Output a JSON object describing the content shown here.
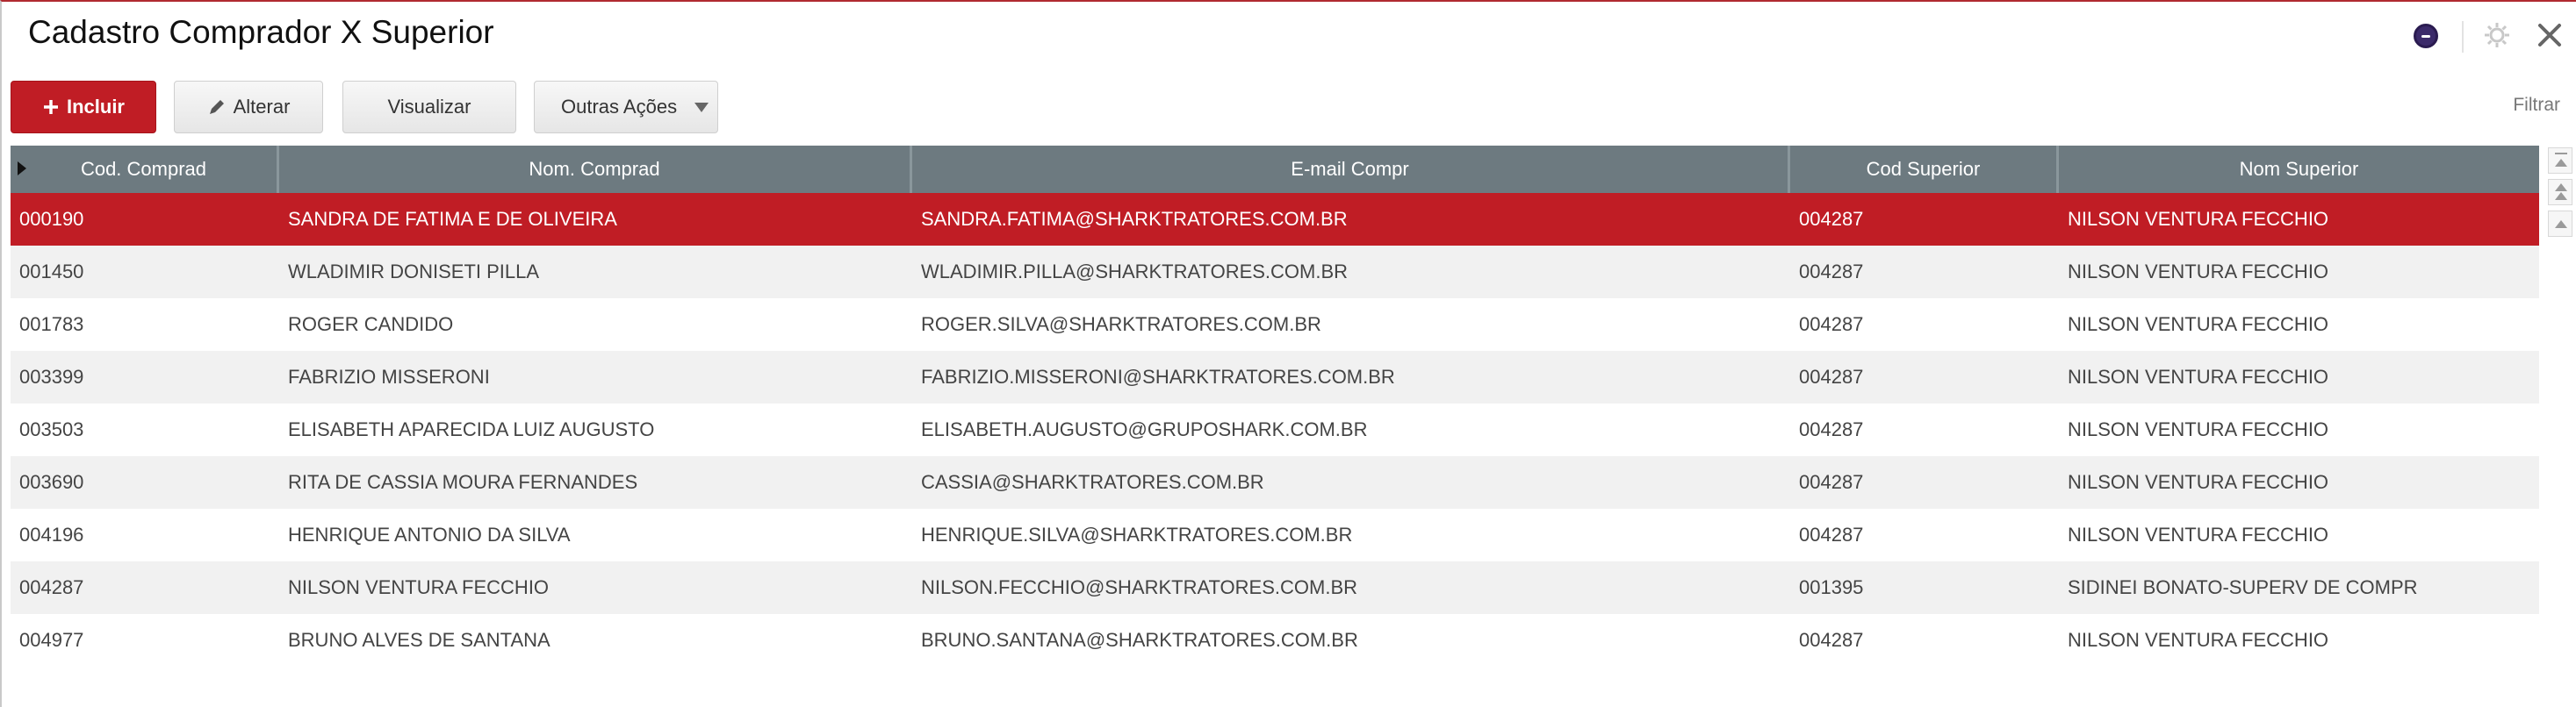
{
  "window": {
    "title": "Cadastro Comprador X Superior"
  },
  "header_icons": {
    "status": "status-icon",
    "settings": "gear-icon",
    "close": "close-icon"
  },
  "toolbar": {
    "incluir_label": "Incluir",
    "alterar_label": "Alterar",
    "visualizar_label": "Visualizar",
    "outras_label": "Outras Ações",
    "filter_label": "Filtrar"
  },
  "colors": {
    "accent": "#c01d25",
    "header_bg": "#6d7a80",
    "row_alt": "#f1f1f1"
  },
  "grid": {
    "columns": [
      "Cod. Comprad",
      "Nom. Comprad",
      "E-mail Compr",
      "Cod Superior",
      "Nom Superior"
    ],
    "selected_row": 0,
    "rows": [
      [
        "000190",
        "SANDRA DE FATIMA E DE OLIVEIRA",
        "SANDRA.FATIMA@SHARKTRATORES.COM.BR",
        "004287",
        "NILSON VENTURA FECCHIO"
      ],
      [
        "001450",
        "WLADIMIR DONISETI PILLA",
        "WLADIMIR.PILLA@SHARKTRATORES.COM.BR",
        "004287",
        "NILSON VENTURA FECCHIO"
      ],
      [
        "001783",
        "ROGER CANDIDO",
        "ROGER.SILVA@SHARKTRATORES.COM.BR",
        "004287",
        "NILSON VENTURA FECCHIO"
      ],
      [
        "003399",
        "FABRIZIO MISSERONI",
        "FABRIZIO.MISSERONI@SHARKTRATORES.COM.BR",
        "004287",
        "NILSON VENTURA FECCHIO"
      ],
      [
        "003503",
        "ELISABETH APARECIDA LUIZ AUGUSTO",
        "ELISABETH.AUGUSTO@GRUPOSHARK.COM.BR",
        "004287",
        "NILSON VENTURA FECCHIO"
      ],
      [
        "003690",
        "RITA DE CASSIA MOURA FERNANDES",
        "CASSIA@SHARKTRATORES.COM.BR",
        "004287",
        "NILSON VENTURA FECCHIO"
      ],
      [
        "004196",
        "HENRIQUE ANTONIO DA SILVA",
        "HENRIQUE.SILVA@SHARKTRATORES.COM.BR",
        "004287",
        "NILSON VENTURA FECCHIO"
      ],
      [
        "004287",
        "NILSON VENTURA FECCHIO",
        "NILSON.FECCHIO@SHARKTRATORES.COM.BR",
        "001395",
        "SIDINEI BONATO-SUPERV DE COMPR"
      ],
      [
        "004977",
        "BRUNO ALVES DE SANTANA",
        "BRUNO.SANTANA@SHARKTRATORES.COM.BR",
        "004287",
        "NILSON VENTURA FECCHIO"
      ]
    ]
  }
}
